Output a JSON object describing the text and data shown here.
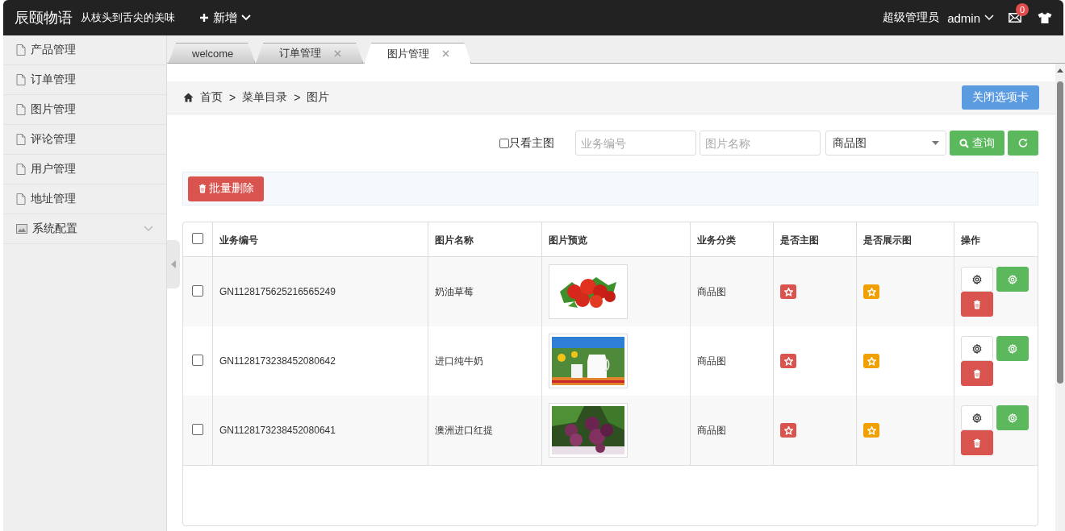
{
  "header": {
    "brand": "辰颐物语",
    "slogan": "从枝头到舌尖的美味",
    "new_menu": "新增",
    "role": "超级管理员",
    "user": "admin",
    "message_count": "0"
  },
  "sidebar": {
    "items": [
      {
        "label": "产品管理",
        "kind": "page"
      },
      {
        "label": "订单管理",
        "kind": "page"
      },
      {
        "label": "图片管理",
        "kind": "page"
      },
      {
        "label": "评论管理",
        "kind": "page"
      },
      {
        "label": "用户管理",
        "kind": "page"
      },
      {
        "label": "地址管理",
        "kind": "page"
      },
      {
        "label": "系统配置",
        "kind": "group",
        "expanded": false
      }
    ]
  },
  "tabs": [
    {
      "label": "welcome",
      "selected": false,
      "closable": false
    },
    {
      "label": "订单管理",
      "selected": false,
      "closable": true
    },
    {
      "label": "图片管理",
      "selected": true,
      "closable": true
    }
  ],
  "breadcrumb": {
    "items": [
      "首页",
      "菜单目录",
      "图片"
    ],
    "separator": ">"
  },
  "close_tabs_button": "关闭选项卡",
  "filters": {
    "main_only": {
      "label": "只看主图",
      "checked": false
    },
    "code_field": {
      "placeholder": "业务编号"
    },
    "name_field": {
      "placeholder": "图片名称"
    },
    "category_select": {
      "value": "商品图"
    },
    "search_button": "查询"
  },
  "batch_delete_button": "批量删除",
  "table": {
    "select_all": false,
    "columns": [
      "业务编号",
      "图片名称",
      "图片预览",
      "业务分类",
      "是否主图",
      "是否展示图",
      "操作"
    ],
    "rows": [
      {
        "selected": false,
        "code": "GN1128175625216565249",
        "name": "奶油草莓",
        "category": "商品图",
        "is_main": true,
        "is_display": true
      },
      {
        "selected": false,
        "code": "GN1128173238452080642",
        "name": "进口纯牛奶",
        "category": "商品图",
        "is_main": true,
        "is_display": true
      },
      {
        "selected": false,
        "code": "GN1128173238452080641",
        "name": "澳洲进口红提",
        "category": "商品图",
        "is_main": true,
        "is_display": true
      }
    ]
  }
}
